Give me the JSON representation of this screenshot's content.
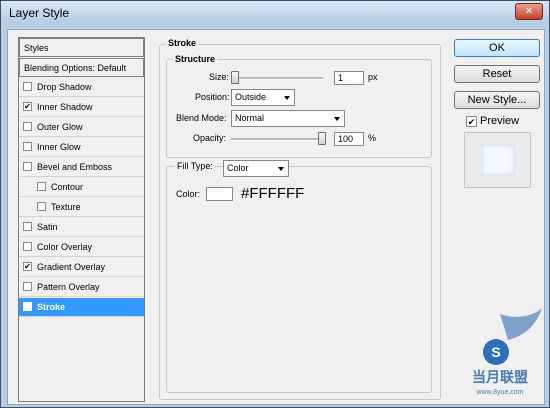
{
  "window": {
    "title": "Layer Style",
    "close_glyph": "✕"
  },
  "styles_panel": {
    "header": "Styles",
    "blending": "Blending Options: Default",
    "items": [
      {
        "label": "Drop Shadow",
        "checked": false,
        "sub": false
      },
      {
        "label": "Inner Shadow",
        "checked": true,
        "sub": false
      },
      {
        "label": "Outer Glow",
        "checked": false,
        "sub": false
      },
      {
        "label": "Inner Glow",
        "checked": false,
        "sub": false
      },
      {
        "label": "Bevel and Emboss",
        "checked": false,
        "sub": false
      },
      {
        "label": "Contour",
        "checked": false,
        "sub": true
      },
      {
        "label": "Texture",
        "checked": false,
        "sub": true
      },
      {
        "label": "Satin",
        "checked": false,
        "sub": false
      },
      {
        "label": "Color Overlay",
        "checked": false,
        "sub": false
      },
      {
        "label": "Gradient Overlay",
        "checked": true,
        "sub": false
      },
      {
        "label": "Pattern Overlay",
        "checked": false,
        "sub": false
      },
      {
        "label": "Stroke",
        "checked": true,
        "sub": false,
        "selected": true
      }
    ]
  },
  "stroke": {
    "title": "Stroke",
    "structure": {
      "title": "Structure",
      "size_label": "Size:",
      "size_value": "1",
      "size_unit": "px",
      "position_label": "Position:",
      "position_value": "Outside",
      "blend_label": "Blend Mode:",
      "blend_value": "Normal",
      "opacity_label": "Opacity:",
      "opacity_value": "100",
      "opacity_unit": "%"
    },
    "fill": {
      "fill_type_label": "Fill Type:",
      "fill_type_value": "Color",
      "color_label": "Color:",
      "color_hex_label": "#FFFFFF"
    }
  },
  "buttons": {
    "ok": "OK",
    "reset": "Reset",
    "new_style": "New Style...",
    "preview_label": "Preview"
  },
  "watermark": {
    "text": "当月联盟",
    "url": "www.8yue.com"
  },
  "colors": {
    "selection": "#3399ff",
    "swatch": "#ffffff"
  },
  "checkmark": "✔"
}
